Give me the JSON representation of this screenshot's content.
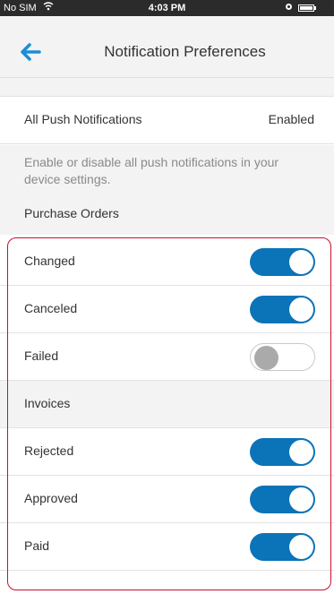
{
  "status_bar": {
    "carrier": "No SIM",
    "time": "4:03 PM"
  },
  "header": {
    "title": "Notification Preferences"
  },
  "push_setting": {
    "label": "All Push Notifications",
    "value": "Enabled"
  },
  "note": {
    "text": "Enable or disable all push notifications in your device settings.",
    "section": "Purchase Orders"
  },
  "purchase_orders": [
    {
      "label": "Changed",
      "enabled": true
    },
    {
      "label": "Canceled",
      "enabled": true
    },
    {
      "label": "Failed",
      "enabled": false
    }
  ],
  "invoices_section": "Invoices",
  "invoices": [
    {
      "label": "Rejected",
      "enabled": true
    },
    {
      "label": "Approved",
      "enabled": true
    },
    {
      "label": "Paid",
      "enabled": true
    }
  ],
  "colors": {
    "accent": "#0b73b8",
    "highlight_border": "#c8102e",
    "background_gray": "#f3f3f3"
  }
}
